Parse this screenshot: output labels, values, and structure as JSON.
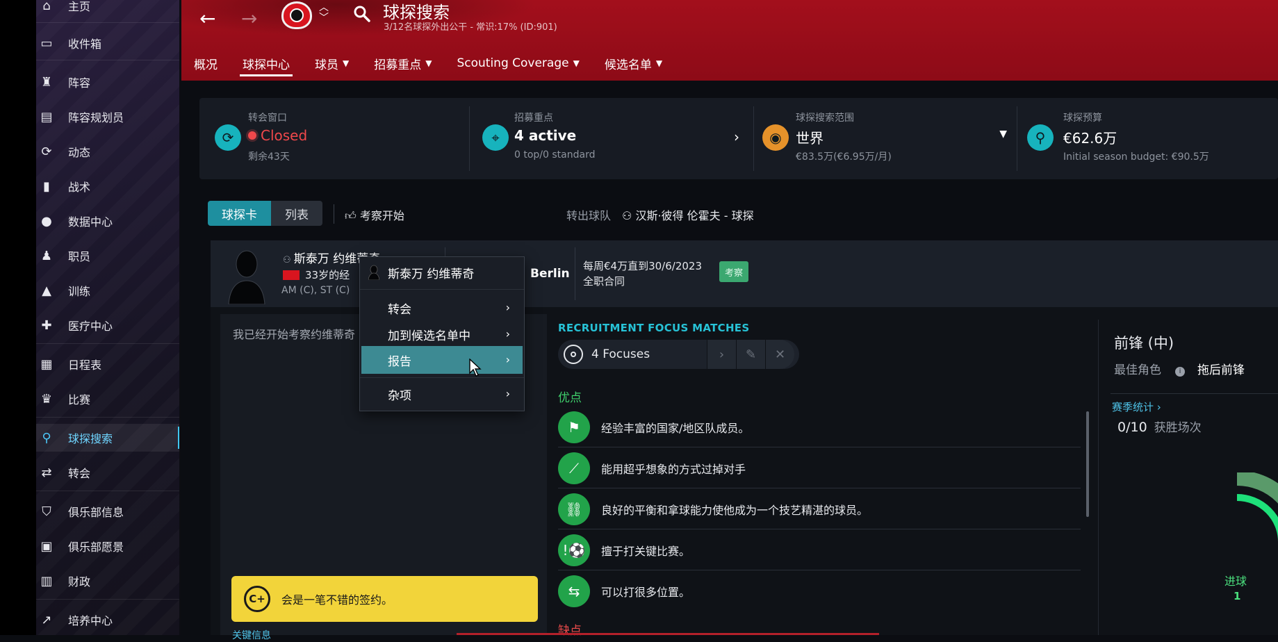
{
  "sidebar": {
    "items": [
      {
        "label": "主页",
        "icon": "home-icon"
      },
      {
        "label": "收件箱",
        "icon": "inbox-icon"
      },
      {
        "label": "阵容",
        "icon": "shirt-icon"
      },
      {
        "label": "阵容规划员",
        "icon": "clipboard-icon"
      },
      {
        "label": "动态",
        "icon": "dynamics-icon"
      },
      {
        "label": "战术",
        "icon": "tactics-board-icon"
      },
      {
        "label": "数据中心",
        "icon": "data-hub-icon"
      },
      {
        "label": "职员",
        "icon": "staff-icon"
      },
      {
        "label": "训练",
        "icon": "cone-icon"
      },
      {
        "label": "医疗中心",
        "icon": "medical-kit-icon"
      },
      {
        "label": "日程表",
        "icon": "calendar-icon"
      },
      {
        "label": "比赛",
        "icon": "trophy-icon"
      },
      {
        "label": "球探搜索",
        "icon": "search-icon"
      },
      {
        "label": "转会",
        "icon": "transfer-arrows-icon"
      },
      {
        "label": "俱乐部信息",
        "icon": "shield-icon"
      },
      {
        "label": "俱乐部愿景",
        "icon": "briefcase-icon"
      },
      {
        "label": "财政",
        "icon": "finances-icon"
      },
      {
        "label": "培养中心",
        "icon": "development-icon"
      }
    ]
  },
  "header": {
    "title": "球探搜索",
    "subtitle": "3/12名球探外出公干 - 常识:17% (ID:901)",
    "tabs": [
      {
        "label": "概况"
      },
      {
        "label": "球探中心"
      },
      {
        "label": "球员"
      },
      {
        "label": "招募重点"
      },
      {
        "label": "Scouting Coverage"
      },
      {
        "label": "候选名单"
      }
    ]
  },
  "summary": {
    "transfer_window": {
      "label": "转会窗口",
      "value": "Closed",
      "sub": "剩余43天"
    },
    "recruitment_focus": {
      "label": "招募重点",
      "value": "4 active",
      "sub": "0 top/0 standard"
    },
    "scouting_range": {
      "label": "球探搜索范围",
      "value": "世界",
      "sub": "€83.5万(€6.95万/月)"
    },
    "scouting_budget": {
      "label": "球探预算",
      "value": "€62.6万",
      "sub": "Initial season budget: €90.5万"
    }
  },
  "toolbar": {
    "view_card": "球探卡",
    "view_list": "列表",
    "start_scouting": "考察开始",
    "transfer_team_label": "转出球队",
    "transfer_team_value": "汉斯·彼得 伦霍夫 - 球探"
  },
  "player": {
    "name": "斯泰万 约维蒂奇",
    "age_text": "33岁的经",
    "positions": "AM (C), ST (C)",
    "club": "Berlin",
    "contract_line1": "每周€4万直到30/6/2023",
    "contract_line2": "全职合同",
    "badge": "考察"
  },
  "report": {
    "text": "我已经开始考察约维蒂奇",
    "verdict": "会是一笔不错的签约。",
    "grade": "C+",
    "next_label": "关键信息"
  },
  "context_menu": {
    "header": "斯泰万 约维蒂奇",
    "items": [
      {
        "label": "转会"
      },
      {
        "label": "加到候选名单中"
      },
      {
        "label": "报告"
      },
      {
        "label": "杂项"
      }
    ]
  },
  "recruitment": {
    "title": "RECRUITMENT FOCUS MATCHES",
    "focuses": "4 Focuses",
    "strengths_title": "优点",
    "strengths": [
      {
        "text": "经验丰富的国家/地区队成员。",
        "icon": "flag-icon"
      },
      {
        "text": "能用超乎想象的方式过掉对手",
        "icon": "dribble-icon"
      },
      {
        "text": "良好的平衡和拿球能力使他成为一个技艺精湛的球员。",
        "icon": "balance-icon"
      },
      {
        "text": "擅于打关键比赛。",
        "icon": "big-match-icon"
      },
      {
        "text": "可以打很多位置。",
        "icon": "versatile-icon"
      }
    ],
    "weaknesses_title": "缺点"
  },
  "side": {
    "position_title": "前锋 (中)",
    "best_role_label": "最佳角色",
    "best_role_value": "拖后前锋",
    "season_stats_link": "赛季统计",
    "season_value": "0/10",
    "season_value_label": "获胜场次",
    "goals_label": "进球",
    "goals_value": "1"
  },
  "colors": {
    "header_red": "#a30f1c",
    "accent_teal": "#1e8f9f",
    "strength_green": "#22a34a",
    "verdict_yellow": "#f2d43a"
  }
}
